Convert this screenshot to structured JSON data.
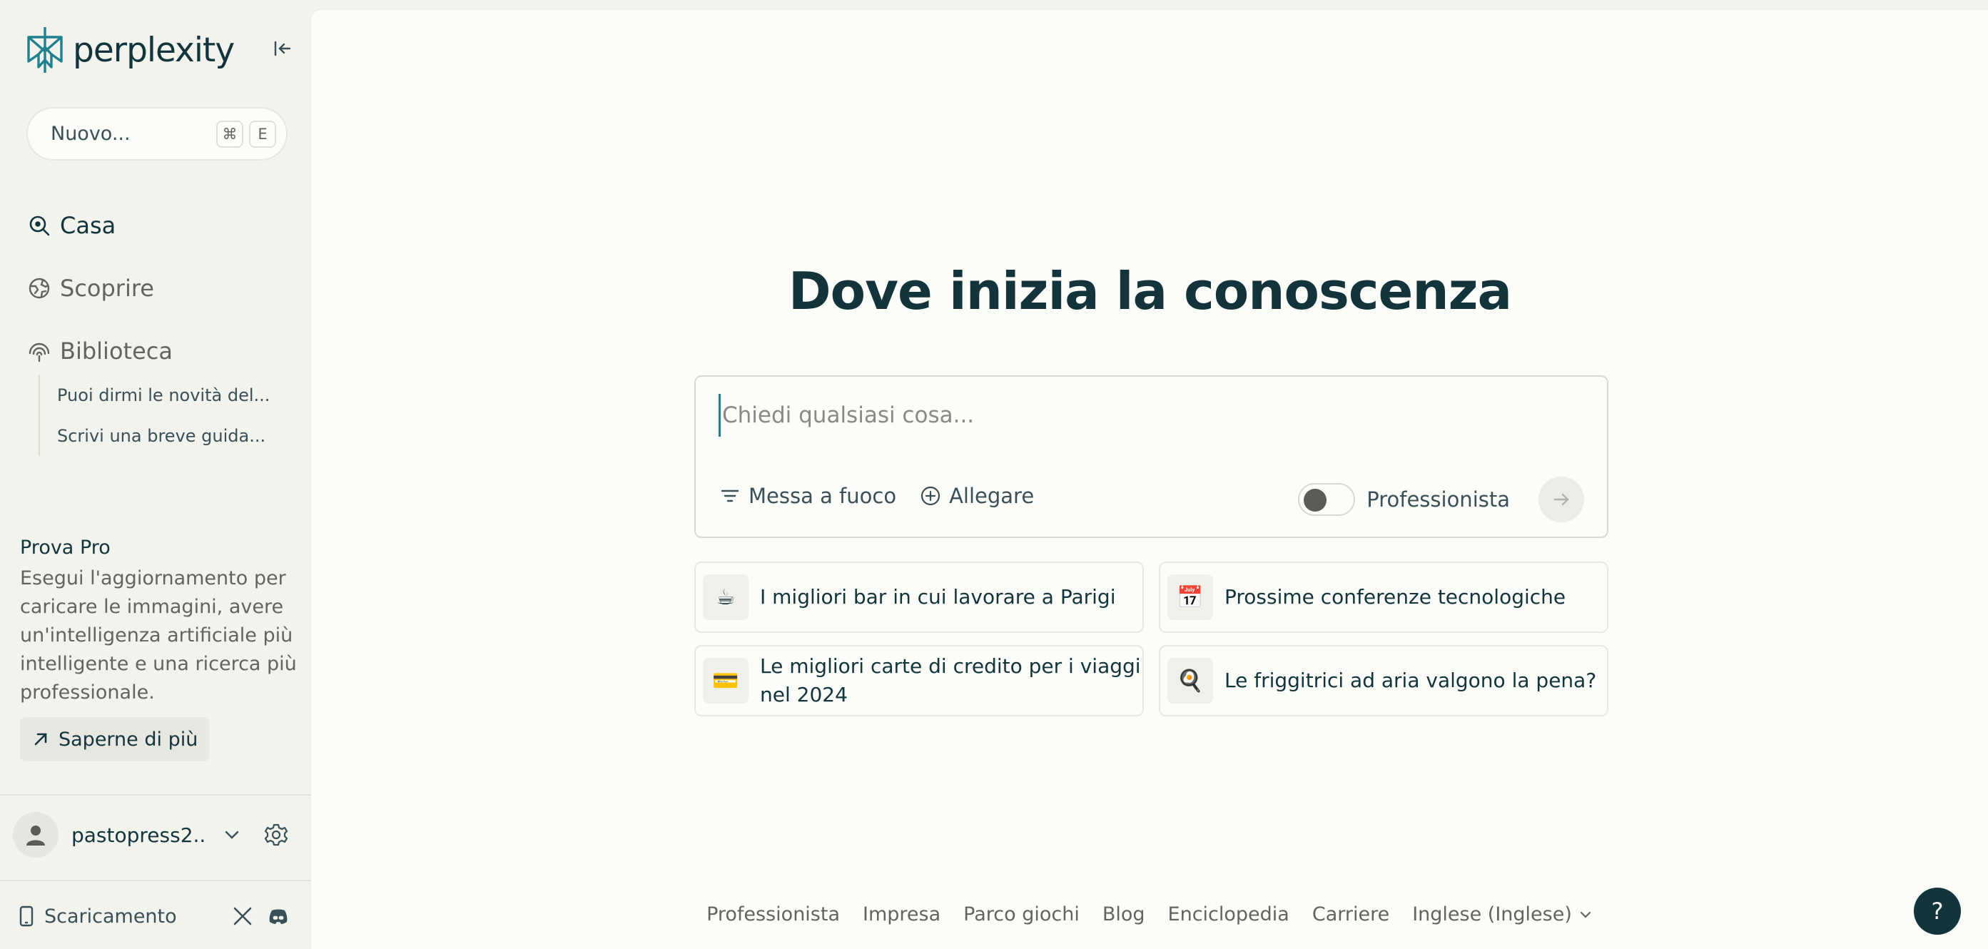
{
  "brand": {
    "name": "perplexity",
    "accent": "#20808d",
    "text": "#13343b"
  },
  "sidebar": {
    "new_label": "Nuovo...",
    "shortcut": [
      "⌘",
      "E"
    ],
    "nav": [
      {
        "label": "Casa",
        "icon": "search-icon"
      },
      {
        "label": "Scoprire",
        "icon": "globe-icon"
      },
      {
        "label": "Biblioteca",
        "icon": "library-icon"
      }
    ],
    "library_items": [
      "Puoi dirmi le novità del...",
      "Scrivi una breve guida..."
    ],
    "pro": {
      "title": "Prova Pro",
      "description": "Esegui l'aggiornamento per caricare le immagini, avere un'intelligenza artificiale più intelligente e una ricerca più professionale.",
      "button": "Saperne di più"
    },
    "user": {
      "name": "pastopress2..."
    },
    "download_label": "Scaricamento"
  },
  "main": {
    "headline": "Dove inizia la conoscenza",
    "search": {
      "placeholder": "Chiedi qualsiasi cosa...",
      "focus_label": "Messa a fuoco",
      "attach_label": "Allegare",
      "pro_label": "Professionista"
    },
    "suggestions": [
      {
        "icon": "☕",
        "text": "I migliori bar in cui lavorare a Parigi"
      },
      {
        "icon": "📅",
        "text": "Prossime conferenze tecnologiche"
      },
      {
        "icon": "💳",
        "text": "Le migliori carte di credito per i viaggi nel 2024"
      },
      {
        "icon": "🍳",
        "text": "Le friggitrici ad aria valgono la pena?"
      }
    ],
    "footer": [
      "Professionista",
      "Impresa",
      "Parco giochi",
      "Blog",
      "Enciclopedia",
      "Carriere"
    ],
    "language": "Inglese (Inglese)",
    "help": "?"
  }
}
